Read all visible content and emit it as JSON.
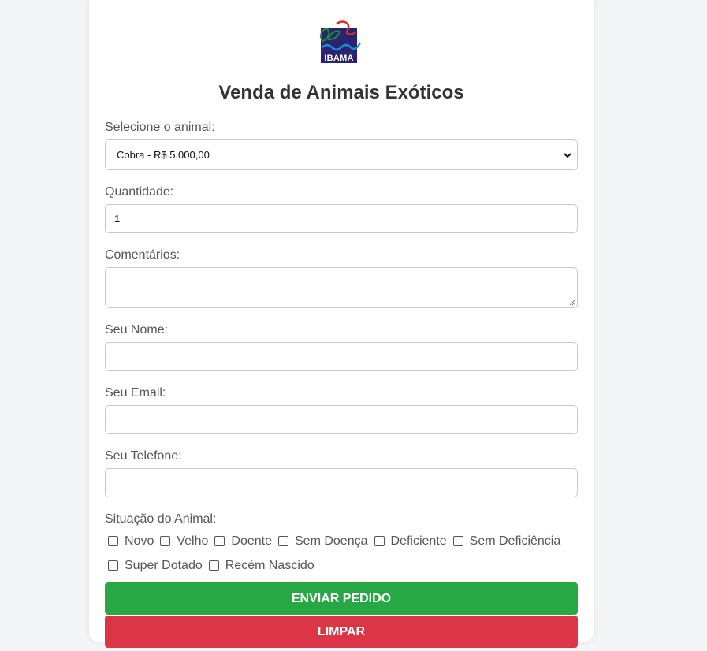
{
  "logo": {
    "text": "IBAMA",
    "colors": {
      "square": "#2a2470",
      "wave": "#1b8fd6",
      "leaf": "#1f8a3a",
      "accent": "#d32f2f"
    }
  },
  "form": {
    "title": "Venda de Animais Exóticos",
    "animal": {
      "label": "Selecione o animal:",
      "selected": "Cobra - R$ 5.000,00"
    },
    "quantity": {
      "label": "Quantidade:",
      "value": "1"
    },
    "comments": {
      "label": "Comentários:",
      "value": ""
    },
    "name": {
      "label": "Seu Nome:",
      "value": ""
    },
    "email": {
      "label": "Seu Email:",
      "value": ""
    },
    "phone": {
      "label": "Seu Telefone:",
      "value": ""
    },
    "status": {
      "label": "Situação do Animal:",
      "options": [
        "Novo",
        "Velho",
        "Doente",
        "Sem Doença",
        "Deficiente",
        "Sem Deficiência",
        "Super Dotado",
        "Recém Nascido"
      ]
    },
    "submit_label": "ENVIAR PEDIDO",
    "clear_label": "LIMPAR"
  },
  "colors": {
    "submit": "#28a745",
    "clear": "#dc3545",
    "background": "#f4f5f7"
  }
}
